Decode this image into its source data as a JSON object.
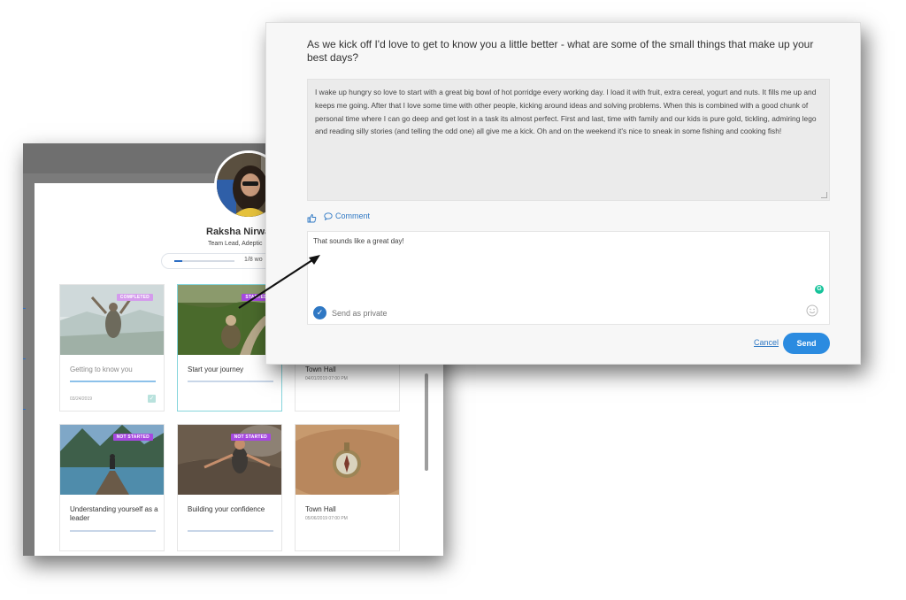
{
  "profile": {
    "name": "Raksha Nirwa",
    "role": "Team Lead, Adeptic",
    "progress_text": "1/8 wo",
    "progress_fraction": 0.125
  },
  "cards": [
    {
      "title": "Getting to know you",
      "badge": "COMPLETED",
      "date": "03/24/2019",
      "checked": true
    },
    {
      "title": "Start your journey",
      "badge": "STARTED"
    },
    {
      "title": "Town Hall",
      "date": "04/01/2019 07:00 PM"
    },
    {
      "title": "Understanding yourself as a leader",
      "badge": "NOT STARTED"
    },
    {
      "title": "Building your confidence",
      "badge": "NOT STARTED"
    },
    {
      "title": "Town Hall",
      "date": "05/06/2019 07:00 PM"
    }
  ],
  "dialog": {
    "question": "As we kick off I'd love to get to know you a little better - what are some of the small things that make up your best days?",
    "answer": "I wake up hungry so love to start with a great big bowl of hot porridge every working day.  I load it with fruit, extra cereal, yogurt and nuts.  It fills me up and keeps me going.  After that I love some time with other people, kicking around ideas and solving problems.  When this is combined with a good chunk of personal time where I can go deep and get lost in a task its almost perfect.  First and last, time with family and our kids is pure gold, tickling, admiring lego and reading silly stories (and telling the odd one) all give me a kick.  Oh and on the weekend it's nice to sneak in some fishing and cooking fish!",
    "comment_label": "Comment",
    "reply_text": "That sounds like a great day!",
    "send_private_label": "Send as private",
    "cancel_label": "Cancel",
    "send_label": "Send"
  },
  "colors": {
    "accent": "#2b8be0",
    "link": "#2f78c4",
    "badge_completed": "#d49bec",
    "badge_not_started": "#a649e0",
    "grammarly": "#15c39a"
  }
}
